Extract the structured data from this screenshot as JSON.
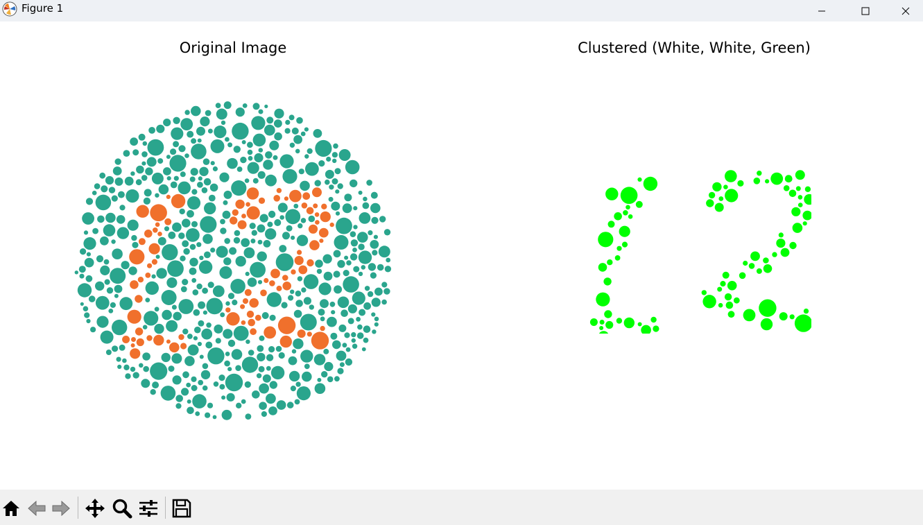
{
  "window": {
    "title": "Figure 1"
  },
  "subplots": [
    {
      "title": "Original Image"
    },
    {
      "title": "Clustered (White, White, Green)"
    }
  ],
  "colors": {
    "teal_dot": "#2aa58d",
    "orange_dot": "#f0702c",
    "green_dot": "#00ff00",
    "titlebar_bg": "#eef1f5",
    "toolbar_bg": "#f0f0f0"
  },
  "toolbar": {
    "buttons": [
      "home-icon",
      "back-arrow-icon",
      "forward-arrow-icon",
      "pan-icon",
      "zoom-icon",
      "configure-subplots-icon",
      "save-icon"
    ]
  }
}
